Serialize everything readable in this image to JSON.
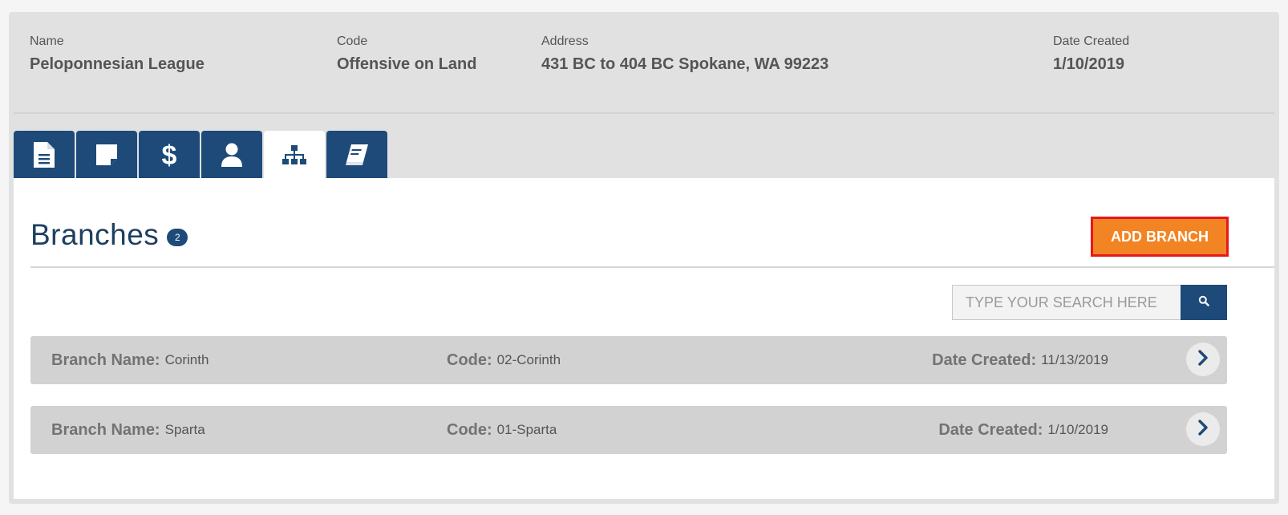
{
  "header": {
    "name_label": "Name",
    "name_value": "Peloponnesian League",
    "code_label": "Code",
    "code_value": "Offensive on Land",
    "address_label": "Address",
    "address_value": "431 BC to 404 BC Spokane, WA 99223",
    "date_label": "Date Created",
    "date_value": "1/10/2019"
  },
  "tabs": [
    {
      "icon": "document-icon",
      "active": false
    },
    {
      "icon": "note-icon",
      "active": false
    },
    {
      "icon": "dollar-icon",
      "active": false
    },
    {
      "icon": "user-icon",
      "active": false
    },
    {
      "icon": "hierarchy-icon",
      "active": true
    },
    {
      "icon": "book-icon",
      "active": false
    }
  ],
  "section": {
    "title": "Branches",
    "count": "2",
    "add_button": "ADD BRANCH"
  },
  "search": {
    "placeholder": "TYPE YOUR SEARCH HERE",
    "button_icon": "search-icon"
  },
  "branches": [
    {
      "name_label": "Branch Name:",
      "name": "Corinth",
      "code_label": "Code:",
      "code": "02-Corinth",
      "date_label": "Date Created:",
      "date": "11/13/2019"
    },
    {
      "name_label": "Branch Name:",
      "name": "Sparta",
      "code_label": "Code:",
      "code": "01-Sparta",
      "date_label": "Date Created:",
      "date": "1/10/2019"
    }
  ],
  "colors": {
    "primary": "#1d4a78",
    "accent": "#f28423",
    "highlight_border": "#e8171d"
  }
}
